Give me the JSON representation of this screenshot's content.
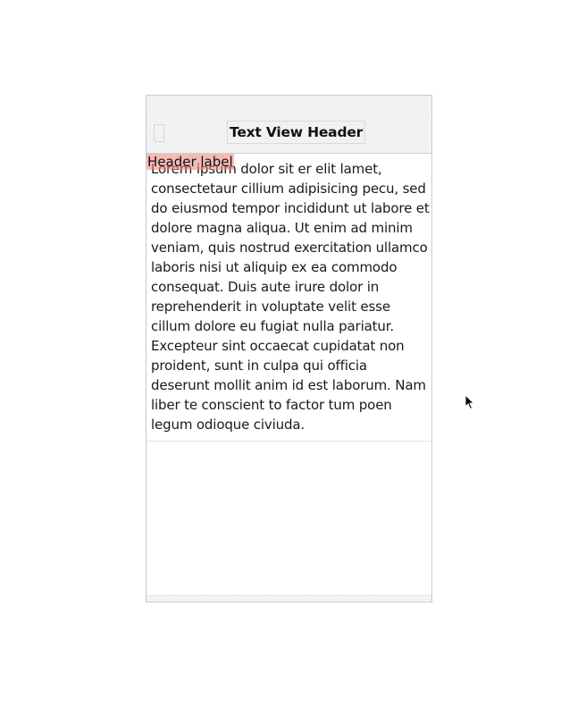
{
  "nav_bar": {
    "title": "Text View Header"
  },
  "header_label": {
    "text": "Header label",
    "background_color": "#ef8278"
  },
  "text_view": {
    "text": "Lorem ipsum dolor sit er elit lamet, consectetaur cillium adipisicing pecu, sed do eiusmod tempor incididunt ut labore et dolore magna aliqua. Ut enim ad minim veniam, quis nostrud exercitation ullamco laboris nisi ut aliquip ex ea commodo consequat. Duis aute irure dolor in reprehenderit in voluptate velit esse cillum dolore eu fugiat nulla pariatur. Excepteur sint occaecat cupidatat non proident, sunt in culpa qui officia deserunt mollit anim id est laborum. Nam liber te conscient to factor tum poen legum odioque civiuda."
  },
  "icons": {
    "cursor": "mouse-pointer-icon"
  }
}
